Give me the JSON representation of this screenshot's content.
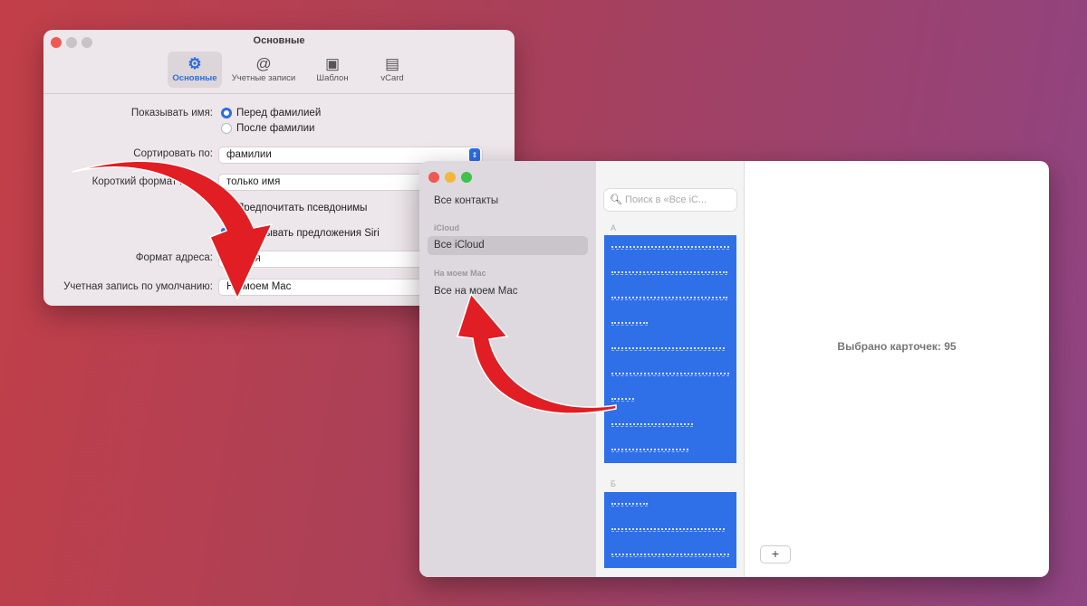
{
  "prefs": {
    "title": "Основные",
    "tabs": [
      {
        "label": "Основные",
        "icon": "gear-icon"
      },
      {
        "label": "Учетные записи",
        "icon": "at-icon"
      },
      {
        "label": "Шаблон",
        "icon": "template-icon"
      },
      {
        "label": "vCard",
        "icon": "vcard-icon"
      }
    ],
    "show_name_label": "Показывать имя:",
    "show_name_options": [
      "Перед фамилией",
      "После фамилии"
    ],
    "sort_label": "Сортировать по:",
    "sort_value": "фамилии",
    "short_label": "Короткий формат имени:",
    "short_value": "только имя",
    "prefer_nicknames": "Предпочитать псевдонимы",
    "siri_suggestions": "Показывать предложения Siri",
    "address_label": "Формат адреса:",
    "address_value": "Россия",
    "default_account_label": "Учетная запись по умолчанию:",
    "default_account_value": "На моем Mac"
  },
  "contacts": {
    "sidebar": {
      "all": "Все контакты",
      "icloud_header": "iCloud",
      "icloud_all": "Все iCloud",
      "mac_header": "На моем Mac",
      "mac_all": "Все на моем Mac"
    },
    "search_placeholder": "Поиск в «Все iC...",
    "sections": [
      {
        "letter": "А",
        "rows": 9
      },
      {
        "letter": "Б",
        "rows": 3
      }
    ],
    "selected_text": "Выбрано карточек: 95",
    "add_label": "+"
  },
  "colors": {
    "accent": "#2f6fe8",
    "arrow": "#e01e24"
  }
}
